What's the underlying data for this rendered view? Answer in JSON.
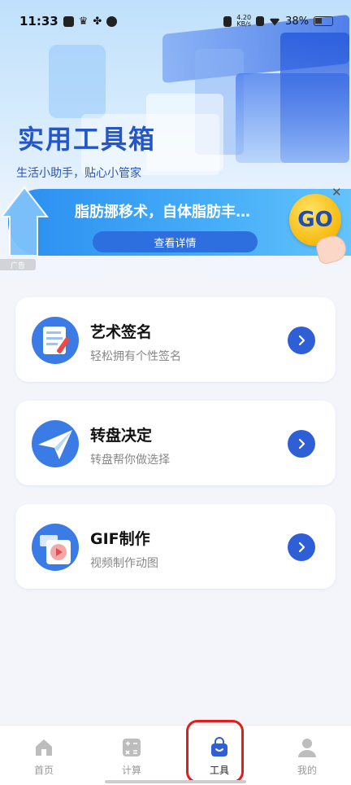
{
  "status_bar": {
    "time": "11:33",
    "net_speed_value": "4.20",
    "net_speed_unit": "KB/s",
    "battery": "38%"
  },
  "header": {
    "title": "实用工具箱",
    "subtitle": "生活小助手，贴心小管家"
  },
  "ad": {
    "text": "脂肪挪移术，自体脂肪丰…",
    "button_label": "查看详情",
    "badge_text": "GO",
    "tag": "广告",
    "close_symbol": "✕"
  },
  "tools": [
    {
      "title": "艺术签名",
      "desc": "轻松拥有个性签名",
      "icon": "signature-doc-icon"
    },
    {
      "title": "转盘决定",
      "desc": "转盘帮你做选择",
      "icon": "paper-plane-icon"
    },
    {
      "title": "GIF制作",
      "desc": "视频制作动图",
      "icon": "gif-file-icon"
    }
  ],
  "nav": {
    "items": [
      {
        "label": "首页",
        "icon": "home-icon",
        "active": false
      },
      {
        "label": "计算",
        "icon": "calculator-icon",
        "active": false
      },
      {
        "label": "工具",
        "icon": "tool-bag-icon",
        "active": true
      },
      {
        "label": "我的",
        "icon": "user-icon",
        "active": false
      }
    ]
  },
  "colors": {
    "accent": "#2f5fd6",
    "title": "#2456c9",
    "highlight": "#e01e1e"
  }
}
